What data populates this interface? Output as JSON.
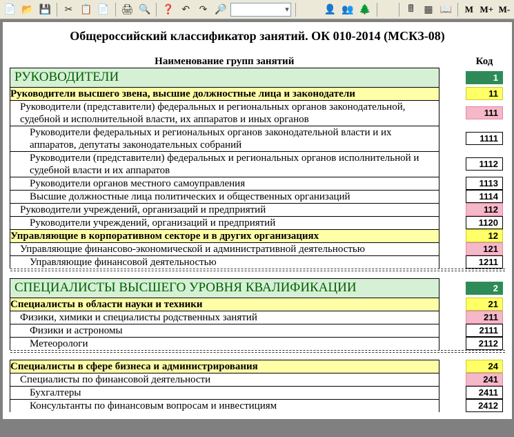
{
  "title": "Общероссийский классификатор занятий. ОК 010-2014 (МСКЗ-08)",
  "columns": {
    "name": "Наименование групп занятий",
    "code": "Код"
  },
  "toolbar": {
    "m": "M",
    "mplus": "M+",
    "mminus": "M-"
  },
  "rows": [
    {
      "lvl": 1,
      "name": "РУКОВОДИТЕЛИ",
      "code": "1"
    },
    {
      "lvl": 2,
      "name": "Руководители высшего звена, высшие должностные лица и законодатели",
      "code": "11"
    },
    {
      "lvl": 3,
      "name": "Руководители (представители) федеральных и региональных органов законодательной, судебной и исполнительной власти, их аппаратов и иных органов",
      "code": "111"
    },
    {
      "lvl": 4,
      "name": "Руководители федеральных и региональных органов законодательной власти и их аппаратов, депутаты законодательных собраний",
      "code": "1111"
    },
    {
      "lvl": 4,
      "name": "Руководители (представители) федеральных и региональных органов исполнительной и судебной власти и их аппаратов",
      "code": "1112"
    },
    {
      "lvl": 4,
      "name": "Руководители органов местного самоуправления",
      "code": "1113"
    },
    {
      "lvl": 4,
      "name": "Высшие должностные лица политических и общественных организаций",
      "code": "1114"
    },
    {
      "lvl": 3,
      "name": "Руководители учреждений, организаций и предприятий",
      "code": "112"
    },
    {
      "lvl": 4,
      "name": "Руководители учреждений, организаций и предприятий",
      "code": "1120"
    },
    {
      "lvl": 2,
      "name": "Управляющие в корпоративном секторе и в других организациях",
      "code": "12"
    },
    {
      "lvl": 3,
      "name": "Управляющие финансово-экономической и административной деятельностью",
      "code": "121"
    },
    {
      "lvl": 4,
      "name": "Управляющие финансовой деятельностью",
      "code": "1211",
      "cut": true
    },
    {
      "gap": true
    },
    {
      "lvl": 1,
      "name": "СПЕЦИАЛИСТЫ ВЫСШЕГО УРОВНЯ КВАЛИФИКАЦИИ",
      "code": "2"
    },
    {
      "lvl": 2,
      "name": "Специалисты в области науки и техники",
      "code": "21"
    },
    {
      "lvl": 3,
      "name": "Физики, химики и специалисты родственных занятий",
      "code": "211"
    },
    {
      "lvl": 4,
      "name": "Физики и астрономы",
      "code": "2111"
    },
    {
      "lvl": 4,
      "name": "Метеорологи",
      "code": "2112",
      "cut": true
    },
    {
      "gap": true
    },
    {
      "lvl": 2,
      "name": "Специалисты в сфере бизнеса и администрирования",
      "code": "24"
    },
    {
      "lvl": 3,
      "name": "Специалисты по финансовой деятельности",
      "code": "241"
    },
    {
      "lvl": 4,
      "name": "Бухгалтеры",
      "code": "2411"
    },
    {
      "lvl": 4,
      "name": "Консультанты по финансовым вопросам и инвестициям",
      "code": "2412",
      "cut": true
    }
  ]
}
